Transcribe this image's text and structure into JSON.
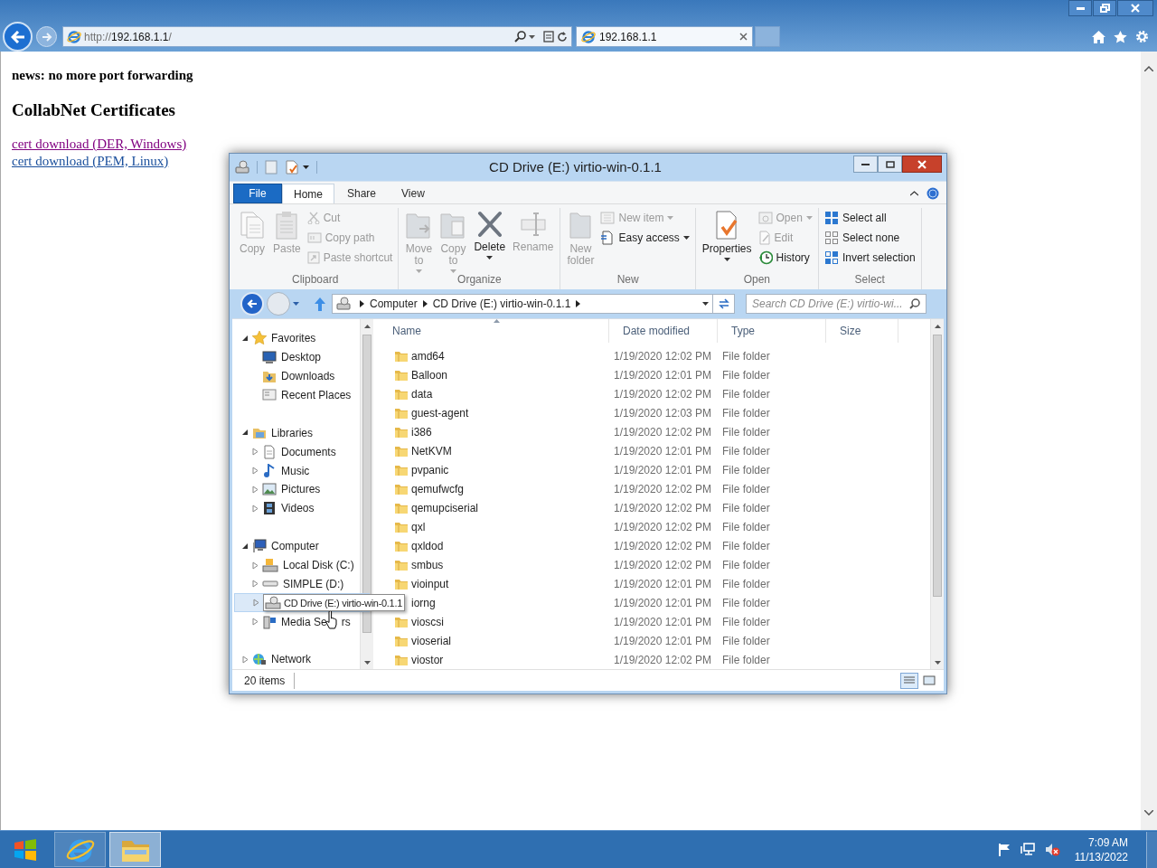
{
  "browser": {
    "address": {
      "scheme": "http://",
      "host": "192.168.1.1",
      "path": "/"
    },
    "tabs": [
      {
        "title": "192.168.1.1",
        "selected": true
      }
    ]
  },
  "page": {
    "news": "news: no more port forwarding",
    "heading": "CollabNet Certificates",
    "links": [
      {
        "text": "cert download (DER, Windows)",
        "visited": true
      },
      {
        "text": "cert download (PEM, Linux)",
        "visited": false
      }
    ]
  },
  "explorer": {
    "title": "CD Drive (E:) virtio-win-0.1.1",
    "ribbon_tabs": [
      {
        "label": "File",
        "kind": "file",
        "selected": false
      },
      {
        "label": "Home",
        "kind": "tab",
        "selected": true
      },
      {
        "label": "Share",
        "kind": "tab",
        "selected": false
      },
      {
        "label": "View",
        "kind": "tab",
        "selected": false
      }
    ],
    "ribbon_groups": [
      {
        "name": "Clipboard",
        "items": [
          {
            "label": "Copy",
            "kind": "large",
            "disabled": true,
            "dropdown": false
          },
          {
            "label": "Paste",
            "kind": "large",
            "disabled": true,
            "dropdown": false
          },
          {
            "label": "Cut",
            "kind": "small",
            "disabled": true,
            "dropdown": false
          },
          {
            "label": "Copy path",
            "kind": "small",
            "disabled": true,
            "dropdown": false
          },
          {
            "label": "Paste shortcut",
            "kind": "small",
            "disabled": true,
            "dropdown": false
          }
        ]
      },
      {
        "name": "Organize",
        "items": [
          {
            "label": "Move to",
            "kind": "large",
            "disabled": true,
            "dropdown": true
          },
          {
            "label": "Copy to",
            "kind": "large",
            "disabled": true,
            "dropdown": true
          },
          {
            "label": "Delete",
            "kind": "large",
            "disabled": false,
            "dropdown": true
          },
          {
            "label": "Rename",
            "kind": "large",
            "disabled": true,
            "dropdown": false
          }
        ]
      },
      {
        "name": "New",
        "items": [
          {
            "label": "New folder",
            "kind": "large",
            "disabled": true,
            "dropdown": false
          },
          {
            "label": "New item",
            "kind": "small",
            "disabled": true,
            "dropdown": true
          },
          {
            "label": "Easy access",
            "kind": "small",
            "disabled": false,
            "dropdown": true
          }
        ]
      },
      {
        "name": "Open",
        "items": [
          {
            "label": "Properties",
            "kind": "large",
            "disabled": false,
            "dropdown": true
          },
          {
            "label": "Open",
            "kind": "small",
            "disabled": true,
            "dropdown": true
          },
          {
            "label": "Edit",
            "kind": "small",
            "disabled": true,
            "dropdown": false
          },
          {
            "label": "History",
            "kind": "small",
            "disabled": false,
            "dropdown": false
          }
        ]
      },
      {
        "name": "Select",
        "items": [
          {
            "label": "Select all",
            "kind": "small",
            "disabled": false,
            "dropdown": false
          },
          {
            "label": "Select none",
            "kind": "small",
            "disabled": false,
            "dropdown": false
          },
          {
            "label": "Invert selection",
            "kind": "small",
            "disabled": false,
            "dropdown": false
          }
        ]
      }
    ],
    "breadcrumb": [
      "Computer",
      "CD Drive (E:) virtio-win-0.1.1"
    ],
    "search": {
      "placeholder": "Search CD Drive (E:) virtio-wi..."
    },
    "nav": [
      {
        "label": "Favorites",
        "expanded": true,
        "children": [
          {
            "label": "Desktop"
          },
          {
            "label": "Downloads"
          },
          {
            "label": "Recent Places"
          }
        ]
      },
      {
        "label": "Libraries",
        "expanded": true,
        "children": [
          {
            "label": "Documents",
            "expanded": false
          },
          {
            "label": "Music",
            "expanded": false
          },
          {
            "label": "Pictures",
            "expanded": false
          },
          {
            "label": "Videos",
            "expanded": false
          }
        ]
      },
      {
        "label": "Computer",
        "expanded": true,
        "children": [
          {
            "label": "Local Disk (C:)",
            "expanded": false,
            "hovered": false
          },
          {
            "label": "SIMPLE (D:)",
            "expanded": false,
            "hovered": false
          },
          {
            "label": "CD Drive (E:) virtio-win-0.1.1",
            "expanded": false,
            "hovered": true
          },
          {
            "label": "Media Se",
            "label_after_cursor": "rs",
            "expanded": false,
            "hovered": false
          }
        ]
      },
      {
        "label": "Network",
        "expanded": false
      }
    ],
    "columns": [
      {
        "label": "Name",
        "sorted": true
      },
      {
        "label": "Date modified",
        "sorted": false
      },
      {
        "label": "Type",
        "sorted": false
      },
      {
        "label": "Size",
        "sorted": false
      }
    ],
    "rows": [
      {
        "name": "amd64",
        "date": "1/19/2020 12:02 PM",
        "type": "File folder"
      },
      {
        "name": "Balloon",
        "date": "1/19/2020 12:01 PM",
        "type": "File folder"
      },
      {
        "name": "data",
        "date": "1/19/2020 12:02 PM",
        "type": "File folder"
      },
      {
        "name": "guest-agent",
        "date": "1/19/2020 12:03 PM",
        "type": "File folder"
      },
      {
        "name": "i386",
        "date": "1/19/2020 12:02 PM",
        "type": "File folder"
      },
      {
        "name": "NetKVM",
        "date": "1/19/2020 12:01 PM",
        "type": "File folder"
      },
      {
        "name": "pvpanic",
        "date": "1/19/2020 12:01 PM",
        "type": "File folder"
      },
      {
        "name": "qemufwcfg",
        "date": "1/19/2020 12:02 PM",
        "type": "File folder"
      },
      {
        "name": "qemupciserial",
        "date": "1/19/2020 12:02 PM",
        "type": "File folder"
      },
      {
        "name": "qxl",
        "date": "1/19/2020 12:02 PM",
        "type": "File folder"
      },
      {
        "name": "qxldod",
        "date": "1/19/2020 12:02 PM",
        "type": "File folder"
      },
      {
        "name": "smbus",
        "date": "1/19/2020 12:02 PM",
        "type": "File folder"
      },
      {
        "name": "vioinput",
        "date": "1/19/2020 12:01 PM",
        "type": "File folder"
      },
      {
        "name": "iorng",
        "date": "1/19/2020 12:01 PM",
        "type": "File folder",
        "icon_covered": true
      },
      {
        "name": "vioscsi",
        "date": "1/19/2020 12:01 PM",
        "type": "File folder"
      },
      {
        "name": "vioserial",
        "date": "1/19/2020 12:01 PM",
        "type": "File folder"
      },
      {
        "name": "viostor",
        "date": "1/19/2020 12:02 PM",
        "type": "File folder"
      }
    ],
    "status": "20 items"
  },
  "taskbar": {
    "apps": [
      {
        "kind": "browser",
        "active": false
      },
      {
        "kind": "explorer",
        "active": true
      }
    ],
    "clock": {
      "time": "7:09 AM",
      "date": "11/13/2022"
    }
  }
}
